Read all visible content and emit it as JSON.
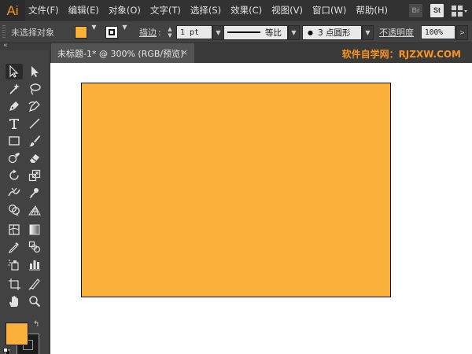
{
  "app": {
    "logo": "Ai"
  },
  "menu": {
    "items": [
      "文件(F)",
      "编辑(E)",
      "对象(O)",
      "文字(T)",
      "选择(S)",
      "效果(C)",
      "视图(V)",
      "窗口(W)",
      "帮助(H)"
    ],
    "bridge_badge": "Br",
    "stock_badge": "St",
    "workspace_icon": "workspace-grid-icon"
  },
  "control": {
    "selection_label": "未选择对象",
    "fill_color": "#fbb03b",
    "stroke_color": "#000000",
    "stroke_label": "描边",
    "stroke_weight": "1 pt",
    "profile_label": "等比",
    "brush_label": "3 点圆形",
    "opacity_label": "不透明度",
    "opacity_value": "100%"
  },
  "tab": {
    "title": "未标题-1* @ 300% (RGB/预览)",
    "close": "×"
  },
  "watermark": "软件自学网：RJZXW.COM",
  "toolbar": {
    "collapse_glyph": "«",
    "active_tool": "selection-tool",
    "fill_color": "#fbb03b",
    "stroke_color": "#000000"
  },
  "artwork": {
    "rect_fill": "#fbb03b",
    "rect_stroke": "#000000"
  }
}
